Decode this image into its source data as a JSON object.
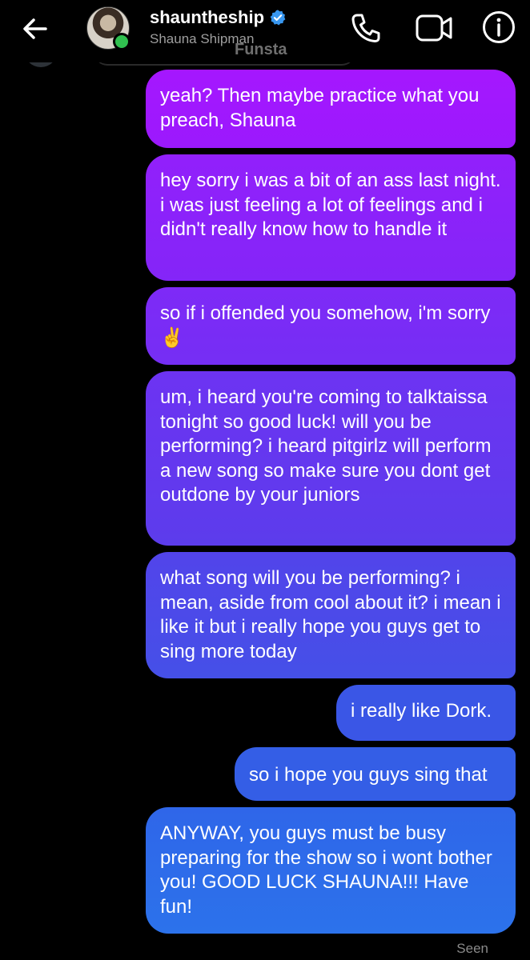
{
  "header": {
    "username": "shauntheship",
    "display_name": "Shauna Shipman",
    "overlay_label": "Funsta",
    "icons": {
      "back": "back-arrow-icon",
      "verified": "verified-badge-icon",
      "call": "phone-call-icon",
      "video": "video-call-icon",
      "info": "info-icon"
    }
  },
  "colors": {
    "background": "#000000",
    "verified": "#3897f0",
    "online": "#30c04f",
    "bubble_top": "#a517fe",
    "bubble_bottom": "#2c72eb"
  },
  "messages": [
    {
      "text": "yeah? Then maybe practice what you preach, Shauna"
    },
    {
      "text": "hey sorry i was a bit of an ass last night. i was just feeling a lot of feelings and i didn't really know how to handle it"
    },
    {
      "text": "so if i offended you somehow, i'm sorry ✌️"
    },
    {
      "text": "um, i heard you're coming to talktaissa tonight so good luck! will you be performing? i heard pitgirlz will perform a new song so make sure you dont get outdone by your juniors"
    },
    {
      "text": "what song will you be performing? i mean, aside from cool about it? i mean i like it but i really hope you guys get to sing more today"
    },
    {
      "text": "i really like Dork."
    },
    {
      "text": "so i hope you guys sing that"
    },
    {
      "text": "ANYWAY, you guys must be busy preparing for the show so i wont bother you! GOOD LUCK SHAUNA!!! Have fun!"
    }
  ],
  "status": {
    "seen": "Seen"
  }
}
